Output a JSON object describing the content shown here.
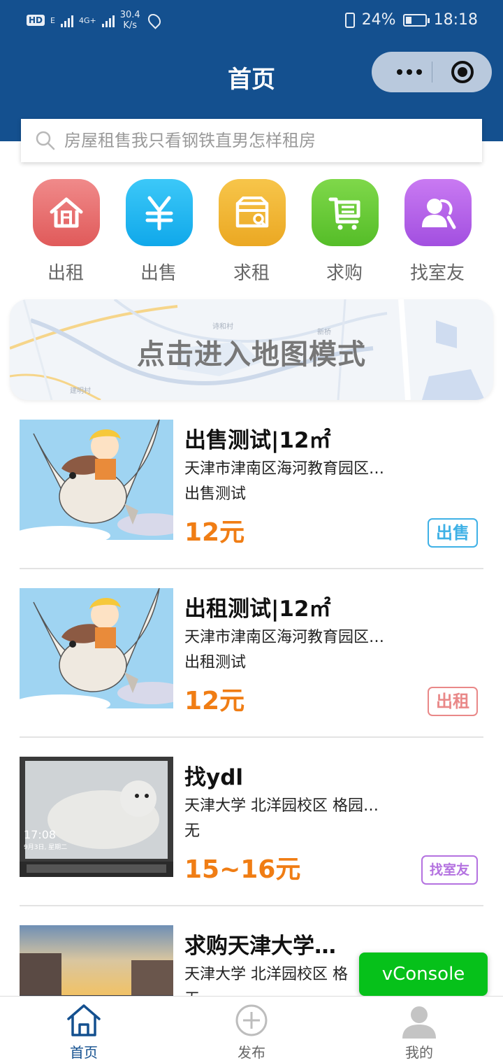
{
  "status_bar": {
    "network": "HD",
    "signal_1": "E",
    "signal_2": "4G+",
    "speed": "30.4",
    "speed_unit": "K/s",
    "battery": "24%",
    "time": "18:18"
  },
  "header": {
    "title": "首页",
    "colors": {
      "header_bg": "#14508f",
      "capsule_bg": "#b9c9dd"
    }
  },
  "search": {
    "placeholder": "房屋租售我只看钢铁直男怎样租房"
  },
  "categories": [
    {
      "label": "出租",
      "icon": "house-icon",
      "color": "#e86a6a"
    },
    {
      "label": "出售",
      "icon": "yen-icon",
      "color": "#1fb4ef"
    },
    {
      "label": "求租",
      "icon": "wallet-search-icon",
      "color": "#f1b431"
    },
    {
      "label": "求购",
      "icon": "cart-icon",
      "color": "#62c832"
    },
    {
      "label": "找室友",
      "icon": "roommate-icon",
      "color": "#b55ee9"
    }
  ],
  "map": {
    "label": "点击进入地图模式",
    "place_labels": [
      "诗和村",
      "新桥",
      "建明村"
    ]
  },
  "listings": [
    {
      "title": "出售测试|12㎡",
      "address": "天津市津南区海河教育园区…",
      "description": "出售测试",
      "price": "12元",
      "tag": "出售",
      "tag_color": "#3fb1e6",
      "image": "bird-character-image"
    },
    {
      "title": "出租测试|12㎡",
      "address": "天津市津南区海河教育园区…",
      "description": "出租测试",
      "price": "12元",
      "tag": "出租",
      "tag_color": "#e98888",
      "image": "bird-character-image"
    },
    {
      "title": "找ydl",
      "address": "天津大学 北洋园校区 格园…",
      "description": "无",
      "price": "15~16元",
      "tag": "找室友",
      "tag_color": "#b472e0",
      "image": "seal-laptop-image",
      "image_caption_time": "17:08",
      "image_caption_date": "9月3日, 星期二"
    },
    {
      "title": "求购天津大学…",
      "address": "天津大学 北洋园校区 格",
      "description": "无",
      "price": "",
      "tag": "",
      "tag_color": "#62c832",
      "image": "sunset-campus-image"
    }
  ],
  "vconsole": {
    "label": "vConsole"
  },
  "tabbar": [
    {
      "label": "首页",
      "icon": "home-icon",
      "active": true
    },
    {
      "label": "发布",
      "icon": "add-circle-icon",
      "active": false
    },
    {
      "label": "我的",
      "icon": "user-icon",
      "active": false
    }
  ]
}
